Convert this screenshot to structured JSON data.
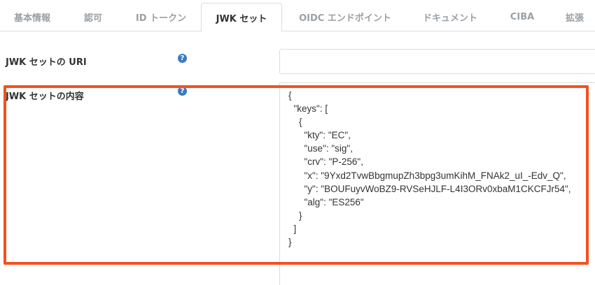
{
  "tabs": [
    {
      "label": "基本情報"
    },
    {
      "label": "認可"
    },
    {
      "label": "ID トークン"
    },
    {
      "label": "JWK セット",
      "active": true
    },
    {
      "label": "OIDC エンドポイント"
    },
    {
      "label": "ドキュメント"
    },
    {
      "label": "CIBA"
    },
    {
      "label": "拡張"
    }
  ],
  "form": {
    "uri": {
      "label": "JWK セットの URI",
      "value": ""
    },
    "content": {
      "label": "JWK セットの内容",
      "value": "{\n  \"keys\": [\n    {\n      \"kty\": \"EC\",\n      \"use\": \"sig\",\n      \"crv\": \"P-256\",\n      \"x\": \"9Yxd2TvwBbgmupZh3bpg3umKihM_FNAk2_uI_-Edv_Q\",\n      \"y\": \"BOUFuyvWoBZ9-RVSeHJLF-L4I3ORv0xbaM1CKCFJr54\",\n      \"alg\": \"ES256\"\n    }\n  ]\n}"
    },
    "help_glyph": "?"
  },
  "icons": {
    "help": "question-circle-icon"
  },
  "colors": {
    "highlight": "#f5511e",
    "help_icon": "#3a7bbf",
    "tab_inactive": "#9aa0a6",
    "tab_active": "#333333"
  }
}
